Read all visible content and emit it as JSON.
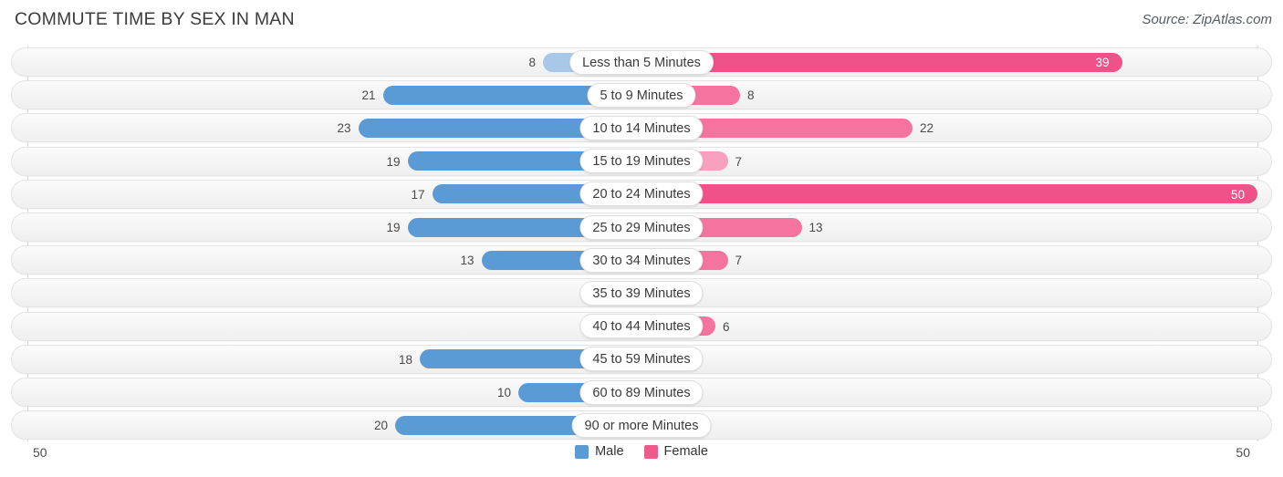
{
  "header": {
    "title": "COMMUTE TIME BY SEX IN MAN",
    "source": "Source: ZipAtlas.com"
  },
  "axis": {
    "left_end_label": "50",
    "right_end_label": "50",
    "max": 50
  },
  "legend": {
    "items": [
      {
        "label": "Male",
        "color": "#5b9bd5"
      },
      {
        "label": "Female",
        "color": "#ef5a8c"
      }
    ]
  },
  "colors": {
    "male_strong": "#5b9bd5",
    "male_light": "#a8c8ea",
    "female_strong": "#ee5289",
    "female_mid": "#f4749f",
    "female_light": "#f9a0be",
    "track_bg": "#f4f4f4",
    "axis": "#dcdcdc"
  },
  "chart_data": {
    "type": "bar",
    "orientation": "horizontal-diverging",
    "title": "COMMUTE TIME BY SEX IN MAN",
    "xlabel": "",
    "ylabel": "",
    "xlim": [
      50,
      50
    ],
    "grid": false,
    "legend_position": "bottom-center",
    "categories": [
      "Less than 5 Minutes",
      "5 to 9 Minutes",
      "10 to 14 Minutes",
      "15 to 19 Minutes",
      "20 to 24 Minutes",
      "25 to 29 Minutes",
      "30 to 34 Minutes",
      "35 to 39 Minutes",
      "40 to 44 Minutes",
      "45 to 59 Minutes",
      "60 to 89 Minutes",
      "90 or more Minutes"
    ],
    "series": [
      {
        "name": "Male",
        "values": [
          8,
          21,
          23,
          19,
          17,
          19,
          13,
          2,
          0,
          18,
          10,
          20
        ]
      },
      {
        "name": "Female",
        "values": [
          39,
          8,
          22,
          7,
          50,
          13,
          7,
          0,
          6,
          1,
          2,
          0
        ]
      }
    ]
  },
  "rows": [
    {
      "label": "Less than 5 Minutes",
      "male": "8",
      "female": "39",
      "male_val": 8,
      "female_val": 39,
      "male_tone": "light",
      "female_tone": "strong",
      "female_inside": true
    },
    {
      "label": "5 to 9 Minutes",
      "male": "21",
      "female": "8",
      "male_val": 21,
      "female_val": 8,
      "male_tone": "strong",
      "female_tone": "mid",
      "female_inside": false
    },
    {
      "label": "10 to 14 Minutes",
      "male": "23",
      "female": "22",
      "male_val": 23,
      "female_val": 22,
      "male_tone": "strong",
      "female_tone": "mid",
      "female_inside": false
    },
    {
      "label": "15 to 19 Minutes",
      "male": "19",
      "female": "7",
      "male_val": 19,
      "female_val": 7,
      "male_tone": "strong",
      "female_tone": "light",
      "female_inside": false
    },
    {
      "label": "20 to 24 Minutes",
      "male": "17",
      "female": "50",
      "male_val": 17,
      "female_val": 50,
      "male_tone": "strong",
      "female_tone": "strong",
      "female_inside": true
    },
    {
      "label": "25 to 29 Minutes",
      "male": "19",
      "female": "13",
      "male_val": 19,
      "female_val": 13,
      "male_tone": "strong",
      "female_tone": "mid",
      "female_inside": false
    },
    {
      "label": "30 to 34 Minutes",
      "male": "13",
      "female": "7",
      "male_val": 13,
      "female_val": 7,
      "male_tone": "strong",
      "female_tone": "mid",
      "female_inside": false
    },
    {
      "label": "35 to 39 Minutes",
      "male": "2",
      "female": "0",
      "male_val": 2,
      "female_val": 0,
      "male_tone": "light",
      "female_tone": "mid",
      "female_inside": false
    },
    {
      "label": "40 to 44 Minutes",
      "male": "0",
      "female": "6",
      "male_val": 0,
      "female_val": 6,
      "male_tone": "light",
      "female_tone": "mid",
      "female_inside": false
    },
    {
      "label": "45 to 59 Minutes",
      "male": "18",
      "female": "1",
      "male_val": 18,
      "female_val": 1,
      "male_tone": "strong",
      "female_tone": "mid",
      "female_inside": false
    },
    {
      "label": "60 to 89 Minutes",
      "male": "10",
      "female": "2",
      "male_val": 10,
      "female_val": 2,
      "male_tone": "strong",
      "female_tone": "mid",
      "female_inside": false
    },
    {
      "label": "90 or more Minutes",
      "male": "20",
      "female": "0",
      "male_val": 20,
      "female_val": 0,
      "male_tone": "strong",
      "female_tone": "mid",
      "female_inside": false
    }
  ]
}
